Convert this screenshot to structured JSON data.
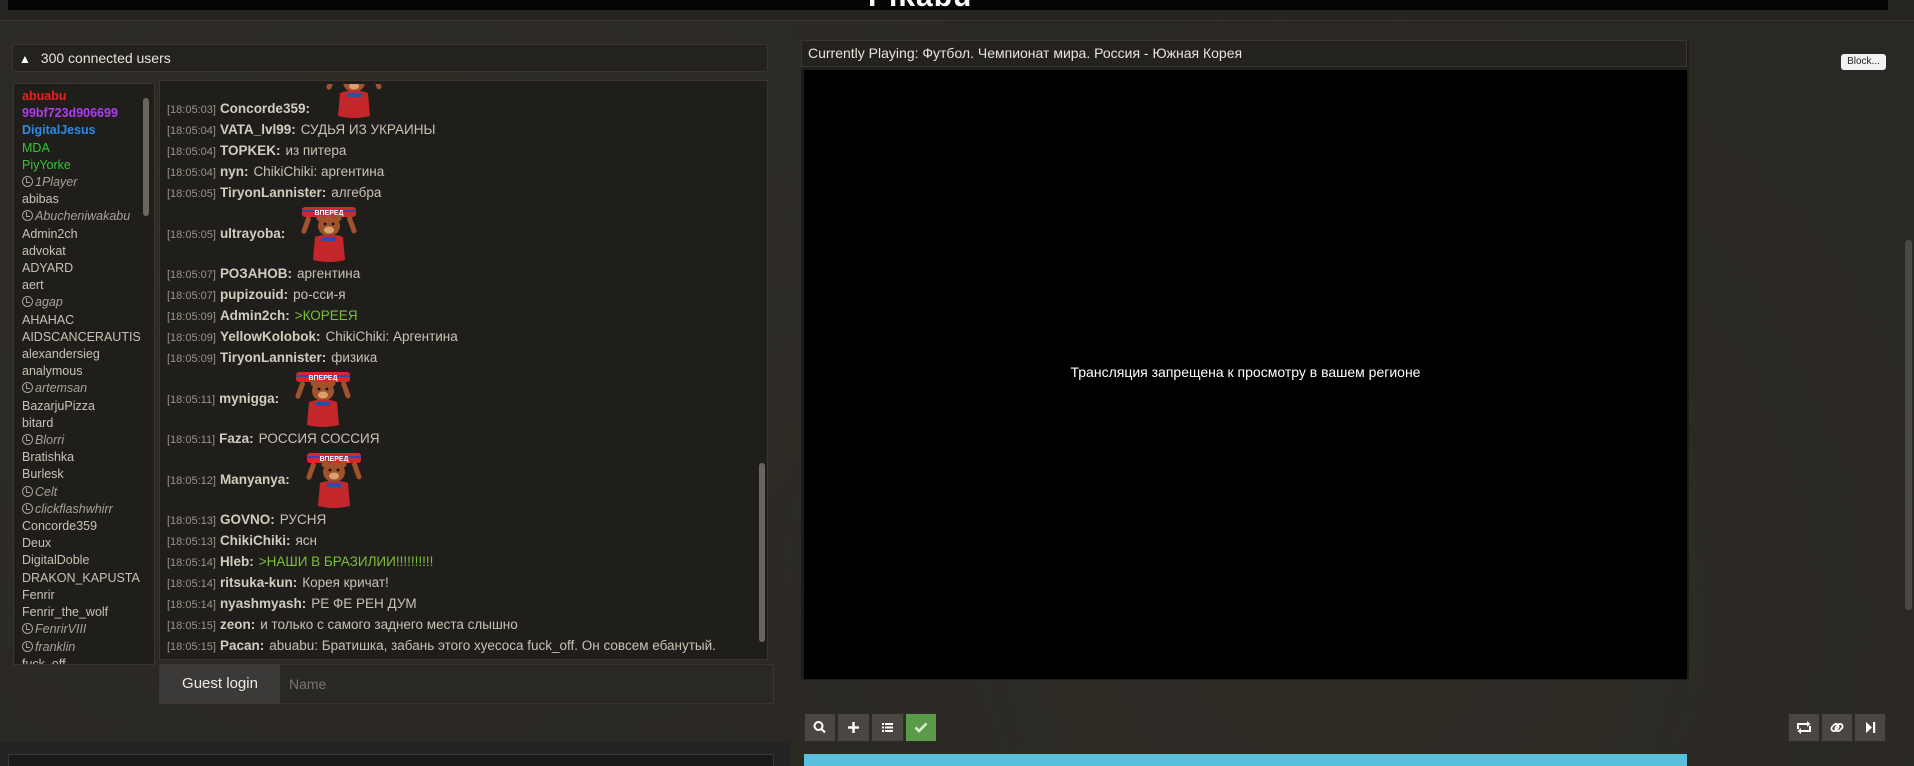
{
  "app": {
    "title": "Pikabu"
  },
  "users": {
    "count_label": "300 connected users",
    "list": [
      {
        "name": "abuabu",
        "style": "red"
      },
      {
        "name": "99bf723d906699",
        "style": "purple"
      },
      {
        "name": "DigitalJesus",
        "style": "blue"
      },
      {
        "name": "MDA",
        "style": "green"
      },
      {
        "name": "PiyYorke",
        "style": "green"
      },
      {
        "name": "1Player",
        "style": "afk"
      },
      {
        "name": "abibas",
        "style": "norm"
      },
      {
        "name": "Abucheniwakabu",
        "style": "afk"
      },
      {
        "name": "Admin2ch",
        "style": "norm"
      },
      {
        "name": "advokat",
        "style": "norm"
      },
      {
        "name": "ADYARD",
        "style": "norm"
      },
      {
        "name": "aert",
        "style": "norm"
      },
      {
        "name": "agap",
        "style": "afk"
      },
      {
        "name": "AHAHAC",
        "style": "norm"
      },
      {
        "name": "AIDSCANCERAUTIS",
        "style": "norm"
      },
      {
        "name": "alexandersieg",
        "style": "norm"
      },
      {
        "name": "analymous",
        "style": "norm"
      },
      {
        "name": "artemsan",
        "style": "afk"
      },
      {
        "name": "BazarjuPizza",
        "style": "norm"
      },
      {
        "name": "bitard",
        "style": "norm"
      },
      {
        "name": "Blorri",
        "style": "afk"
      },
      {
        "name": "Bratishka",
        "style": "norm"
      },
      {
        "name": "Burlesk",
        "style": "norm"
      },
      {
        "name": "Celt",
        "style": "afk"
      },
      {
        "name": "clickflashwhirr",
        "style": "afk"
      },
      {
        "name": "Concorde359",
        "style": "norm"
      },
      {
        "name": "Deux",
        "style": "norm"
      },
      {
        "name": "DigitalDoble",
        "style": "norm"
      },
      {
        "name": "DRAKON_KAPUSTA",
        "style": "norm"
      },
      {
        "name": "Fenrir",
        "style": "norm"
      },
      {
        "name": "Fenrir_the_wolf",
        "style": "norm"
      },
      {
        "name": "FenrirVIII",
        "style": "afk"
      },
      {
        "name": "franklin",
        "style": "afk"
      },
      {
        "name": "fuck_off",
        "style": "norm"
      }
    ]
  },
  "chat": {
    "messages": [
      {
        "time": "[18:05:03]",
        "nick": "Concorde359:",
        "text": "",
        "emote": true,
        "cut": true
      },
      {
        "time": "[18:05:04]",
        "nick": "VATA_lvl99:",
        "text": "СУДЬЯ ИЗ УКРАИНЫ"
      },
      {
        "time": "[18:05:04]",
        "nick": "TOPKEK:",
        "text": "из питера"
      },
      {
        "time": "[18:05:04]",
        "nick": "nyn:",
        "text": "ChikiChiki: аргентина"
      },
      {
        "time": "[18:05:05]",
        "nick": "TiryonLannister:",
        "text": "алгебра"
      },
      {
        "time": "[18:05:05]",
        "nick": "ultrayoba:",
        "text": "",
        "emote": true
      },
      {
        "time": "[18:05:07]",
        "nick": "РОЗАНОВ:",
        "text": "аргентина"
      },
      {
        "time": "[18:05:07]",
        "nick": "pupizouid:",
        "text": "ро-сси-я"
      },
      {
        "time": "[18:05:09]",
        "nick": "Admin2ch:",
        "text": ">КОРЕЕЯ",
        "green": true
      },
      {
        "time": "[18:05:09]",
        "nick": "YellowKolobok:",
        "text": "ChikiChiki: Аргентина"
      },
      {
        "time": "[18:05:09]",
        "nick": "TiryonLannister:",
        "text": "физика"
      },
      {
        "time": "[18:05:11]",
        "nick": "mynigga:",
        "text": "",
        "emote": true
      },
      {
        "time": "[18:05:11]",
        "nick": "Faza:",
        "text": "РОССИЯ СОССИЯ"
      },
      {
        "time": "[18:05:12]",
        "nick": "Manyanya:",
        "text": "",
        "emote": true
      },
      {
        "time": "[18:05:13]",
        "nick": "GOVNO:",
        "text": "РУСНЯ"
      },
      {
        "time": "[18:05:13]",
        "nick": "ChikiChiki:",
        "text": "ясн"
      },
      {
        "time": "[18:05:14]",
        "nick": "Hleb:",
        "text": ">НАШИ В БРАЗИЛИИ!!!!!!!!!!",
        "green": true
      },
      {
        "time": "[18:05:14]",
        "nick": "ritsuka-kun:",
        "text": "Корея кричат!"
      },
      {
        "time": "[18:05:14]",
        "nick": "nyashmyash:",
        "text": "РЕ ФЕ РЕН ДУМ"
      },
      {
        "time": "[18:05:15]",
        "nick": "zeon:",
        "text": "и только с самого заднего места слышно"
      },
      {
        "time": "[18:05:15]",
        "nick": "Pacan:",
        "text": "abuabu: Братишка, забань этого хуесоса fuck_off. Он совсем ебанутый."
      }
    ],
    "emote_label": "ВПЕРЕД"
  },
  "login": {
    "guest_button": "Guest login",
    "name_placeholder": "Name"
  },
  "player": {
    "now_playing": "Currently Playing: Футбол. Чемпионат мира. Россия - Южная Корея",
    "block_label": "Block...",
    "geo_message": "Трансляция запрещена к просмотру в вашем регионе"
  },
  "colors": {
    "accent_green": "#5a9a4a",
    "info_bar": "#5bc0de",
    "user_red": "#e8231c",
    "user_purple": "#b03cf0",
    "user_blue": "#2a8be8",
    "user_green": "#33c733",
    "greentext": "#7bbf3a"
  }
}
